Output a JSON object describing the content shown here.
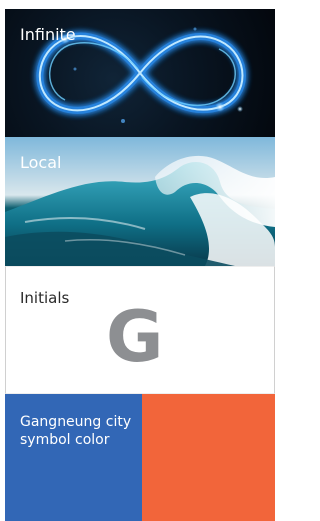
{
  "panels": {
    "infinite": {
      "label": "Infinite"
    },
    "local": {
      "label": "Local"
    },
    "initials": {
      "label": "Initials",
      "letter": "G"
    },
    "symbol_color": {
      "label_line1": "Gangneung city",
      "label_line2": "symbol color",
      "colors": {
        "blue": "#3267b6",
        "orange": "#f2653a"
      }
    }
  }
}
